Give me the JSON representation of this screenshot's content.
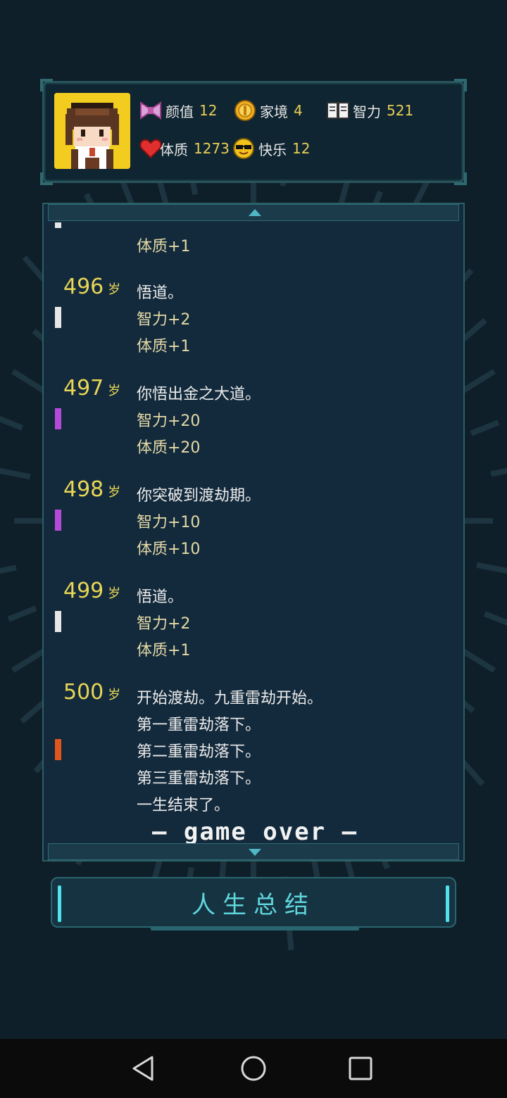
{
  "stats": [
    {
      "key": "appearance",
      "icon": "bow-icon",
      "label": "颜值",
      "value": "12"
    },
    {
      "key": "family",
      "icon": "coin-icon",
      "label": "家境",
      "value": "4"
    },
    {
      "key": "intelligence",
      "icon": "book-icon",
      "label": "智力",
      "value": "521"
    },
    {
      "key": "physique",
      "icon": "heart-icon",
      "label": "体质",
      "value": "1273"
    },
    {
      "key": "happiness",
      "icon": "sunglasses-face-icon",
      "label": "快乐",
      "value": "12"
    }
  ],
  "log": {
    "top_partial": {
      "lines": [
        "体质+1"
      ]
    },
    "entries": [
      {
        "age": "496",
        "unit": "岁",
        "grade_color": "#e6e6e6",
        "event": "悟道。",
        "effects": [
          "智力+2",
          "体质+1"
        ]
      },
      {
        "age": "497",
        "unit": "岁",
        "grade_color": "#b54ad9",
        "event": "你悟出金之大道。",
        "effects": [
          "智力+20",
          "体质+20"
        ]
      },
      {
        "age": "498",
        "unit": "岁",
        "grade_color": "#b54ad9",
        "event": "你突破到渡劫期。",
        "effects": [
          "智力+10",
          "体质+10"
        ]
      },
      {
        "age": "499",
        "unit": "岁",
        "grade_color": "#e6e6e6",
        "event": "悟道。",
        "effects": [
          "智力+2",
          "体质+1"
        ]
      },
      {
        "age": "500",
        "unit": "岁",
        "grade_color": "#e0561c",
        "event": "开始渡劫。九重雷劫开始。",
        "effects": [
          "第一重雷劫落下。",
          "第二重雷劫落下。",
          "第三重雷劫落下。",
          "一生结束了。"
        ]
      }
    ],
    "game_over": "— game over —"
  },
  "summary_button": {
    "label": "人生总结"
  },
  "nav": {
    "back": "back-icon",
    "home": "home-icon",
    "recents": "recents-icon"
  }
}
